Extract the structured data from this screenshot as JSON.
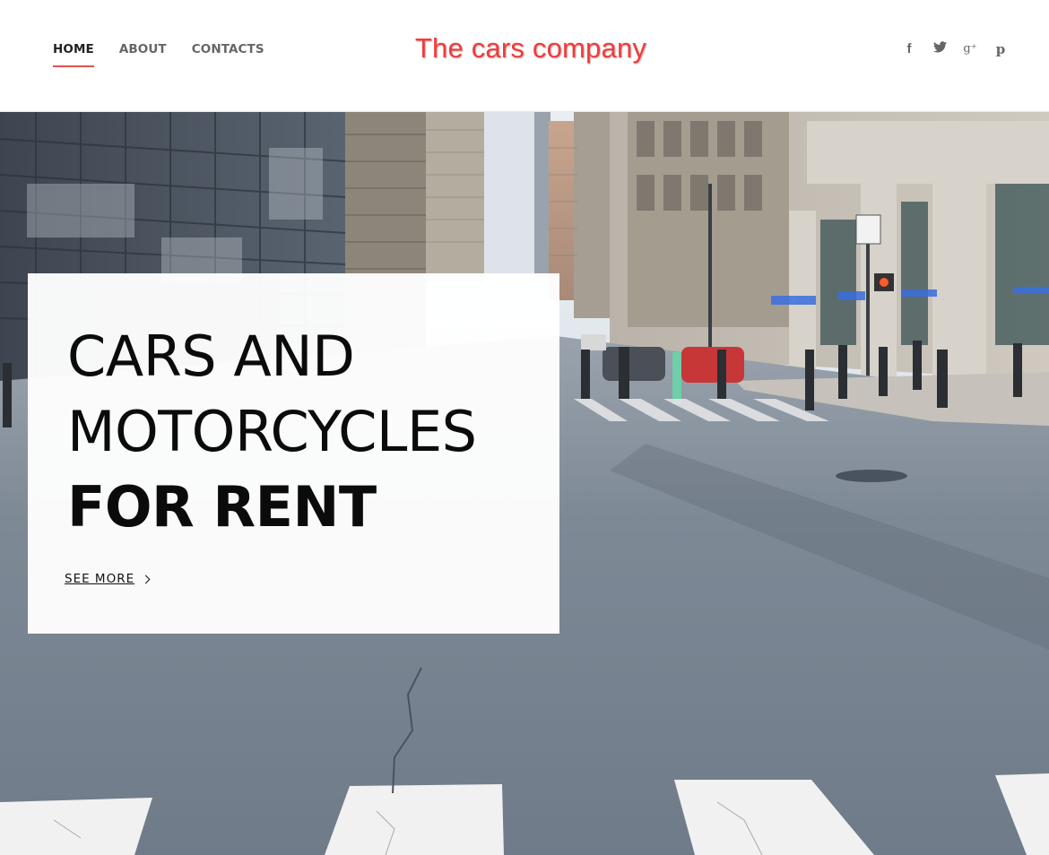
{
  "nav": {
    "items": [
      {
        "label": "HOME",
        "active": true
      },
      {
        "label": "ABOUT",
        "active": false
      },
      {
        "label": "CONTACTS",
        "active": false
      }
    ]
  },
  "brand": {
    "logo_text": "The cars company",
    "logo_color": "#f03c3c"
  },
  "social": {
    "icons": [
      "facebook-icon",
      "twitter-icon",
      "google-plus-icon",
      "pinterest-icon"
    ],
    "glyphs": {
      "facebook": "f",
      "twitter": "🐦",
      "google_plus": "g⁺",
      "pinterest": "p"
    }
  },
  "hero": {
    "headline_line1": "CARS AND",
    "headline_line2": "MOTORCYCLES",
    "headline_line3": "FOR RENT",
    "cta_label": "SEE MORE"
  },
  "colors": {
    "accent": "#e2524f",
    "nav_text": "#666666",
    "nav_active": "#222222"
  }
}
